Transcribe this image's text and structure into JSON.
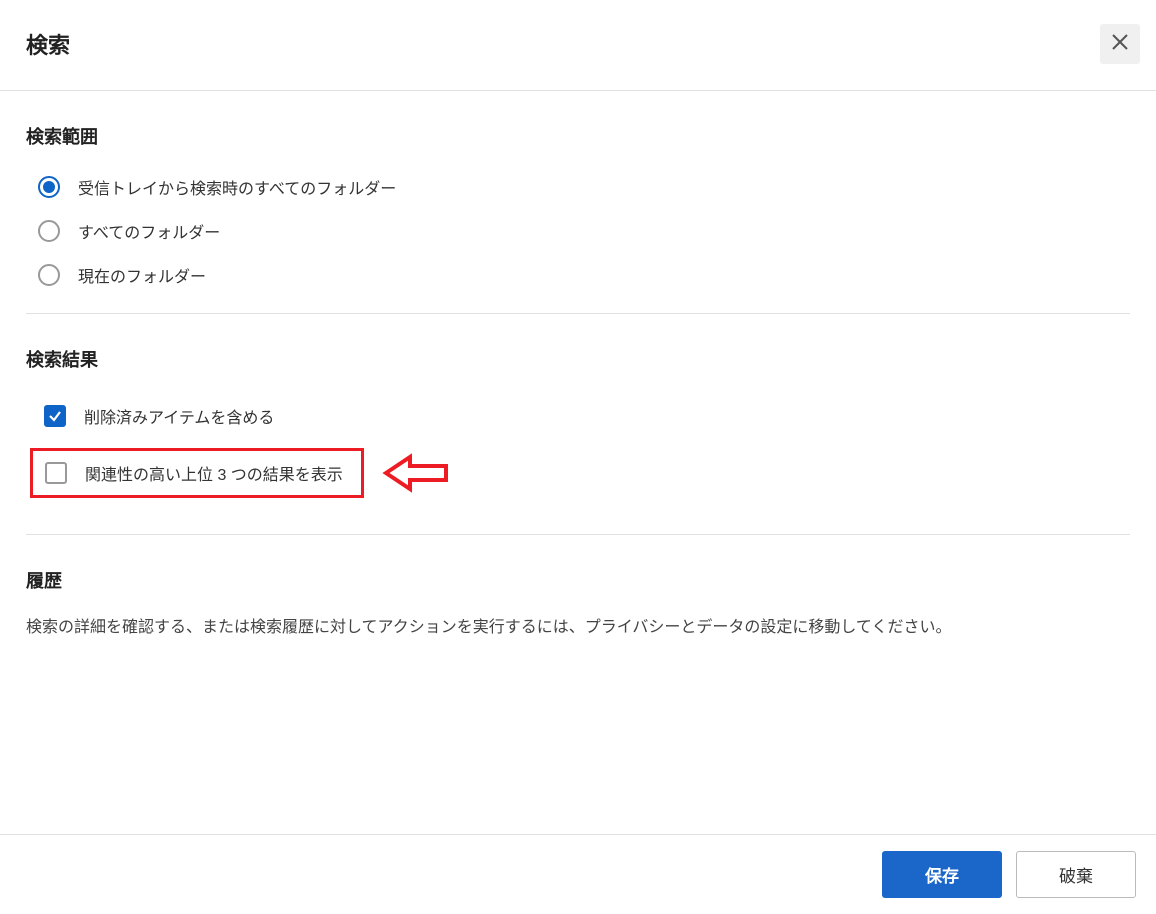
{
  "header": {
    "title": "検索"
  },
  "sections": {
    "scope": {
      "title": "検索範囲",
      "options": [
        {
          "label": "受信トレイから検索時のすべてのフォルダー",
          "selected": true
        },
        {
          "label": "すべてのフォルダー",
          "selected": false
        },
        {
          "label": "現在のフォルダー",
          "selected": false
        }
      ]
    },
    "results": {
      "title": "検索結果",
      "options": [
        {
          "label": "削除済みアイテムを含める",
          "checked": true
        },
        {
          "label": "関連性の高い上位 3 つの結果を表示",
          "checked": false
        }
      ]
    },
    "history": {
      "title": "履歴",
      "description": "検索の詳細を確認する、または検索履歴に対してアクションを実行するには、プライバシーとデータの設定に移動してください。"
    }
  },
  "footer": {
    "save_label": "保存",
    "discard_label": "破棄"
  },
  "annotation": {
    "highlight_color": "#ed1c24"
  }
}
